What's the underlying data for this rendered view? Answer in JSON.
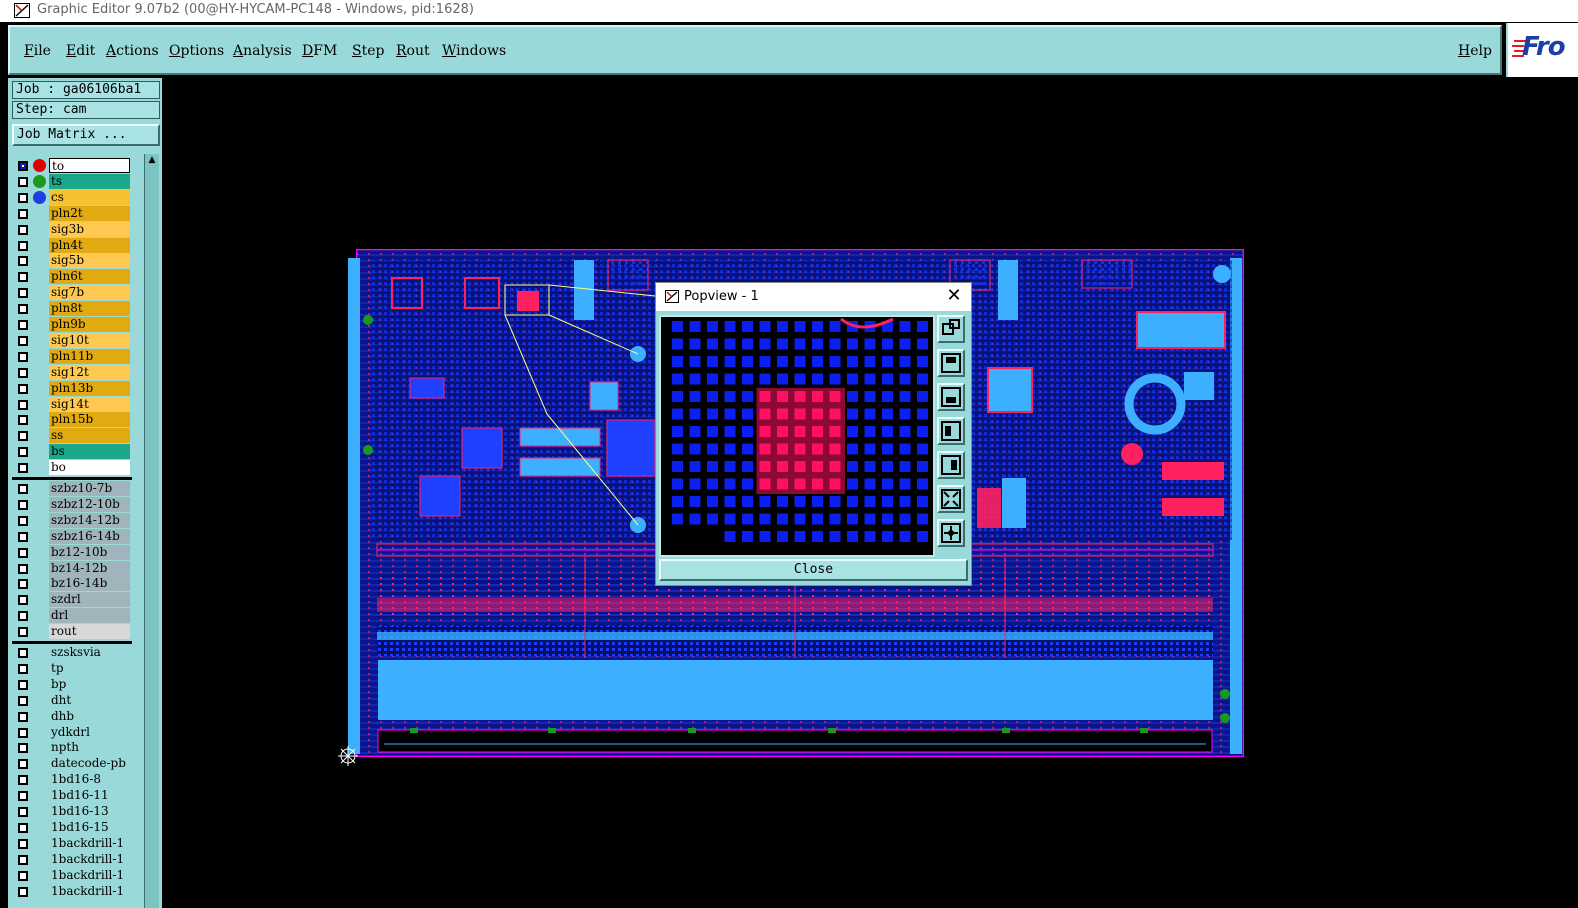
{
  "window": {
    "title": "Graphic Editor 9.07b2 (00@HY-HYCAM-PC148 - Windows, pid:1628)"
  },
  "menu": {
    "items": [
      {
        "label": "File",
        "name": "file"
      },
      {
        "label": "Edit",
        "name": "edit"
      },
      {
        "label": "Actions",
        "name": "actions"
      },
      {
        "label": "Options",
        "name": "options"
      },
      {
        "label": "Analysis",
        "name": "analysis"
      },
      {
        "label": "DFM",
        "name": "dfm"
      },
      {
        "label": "Step",
        "name": "step"
      },
      {
        "label": "Rout",
        "name": "rout"
      },
      {
        "label": "Windows",
        "name": "windows"
      }
    ],
    "help": "Help",
    "logo": "Fro"
  },
  "panel": {
    "job": "Job : ga06106ba1",
    "step": "Step: cam",
    "job_matrix": "Job Matrix ..."
  },
  "layers": {
    "board": [
      {
        "name": "to",
        "bg": "#ffffff",
        "dot": "#e00000",
        "checked": true,
        "active": true
      },
      {
        "name": "ts",
        "bg": "#1aa78a",
        "dot": "#1a9a1a"
      },
      {
        "name": "cs",
        "bg": "#f4c230",
        "dot": "#1f3fe0"
      },
      {
        "name": "pln2t",
        "bg": "#e0aa10"
      },
      {
        "name": "sig3b",
        "bg": "#ffc850"
      },
      {
        "name": "pln4t",
        "bg": "#e0aa10"
      },
      {
        "name": "sig5b",
        "bg": "#ffc850"
      },
      {
        "name": "pln6t",
        "bg": "#e0aa10"
      },
      {
        "name": "sig7b",
        "bg": "#ffc850"
      },
      {
        "name": "pln8t",
        "bg": "#e0aa10"
      },
      {
        "name": "pln9b",
        "bg": "#e0aa10"
      },
      {
        "name": "sig10t",
        "bg": "#ffc850"
      },
      {
        "name": "pln11b",
        "bg": "#e0aa10"
      },
      {
        "name": "sig12t",
        "bg": "#ffc850"
      },
      {
        "name": "pln13b",
        "bg": "#e0aa10"
      },
      {
        "name": "sig14t",
        "bg": "#ffc850"
      },
      {
        "name": "pln15b",
        "bg": "#e0aa10"
      },
      {
        "name": "ss",
        "bg": "#e0aa10"
      },
      {
        "name": "bs",
        "bg": "#1aa78a"
      },
      {
        "name": "bo",
        "bg": "#ffffff"
      }
    ],
    "drill": [
      {
        "name": "szbz10-7b",
        "bg": "#a0b4bc"
      },
      {
        "name": "szbz12-10b",
        "bg": "#a0b4bc"
      },
      {
        "name": "szbz14-12b",
        "bg": "#a0b4bc"
      },
      {
        "name": "szbz16-14b",
        "bg": "#a0b4bc"
      },
      {
        "name": "bz12-10b",
        "bg": "#a0b4bc"
      },
      {
        "name": "bz14-12b",
        "bg": "#a0b4bc"
      },
      {
        "name": "bz16-14b",
        "bg": "#a0b4bc"
      },
      {
        "name": "szdrl",
        "bg": "#a0b4bc"
      },
      {
        "name": "drl",
        "bg": "#a0b4bc"
      },
      {
        "name": "rout",
        "bg": "#d8d8d8"
      }
    ],
    "misc": [
      {
        "name": "szsksvia",
        "bg": "#9ad9d9"
      },
      {
        "name": "tp",
        "bg": "#9ad9d9"
      },
      {
        "name": "bp",
        "bg": "#9ad9d9"
      },
      {
        "name": "dht",
        "bg": "#9ad9d9"
      },
      {
        "name": "dhb",
        "bg": "#9ad9d9"
      },
      {
        "name": "ydkdrl",
        "bg": "#9ad9d9"
      },
      {
        "name": "npth",
        "bg": "#9ad9d9"
      },
      {
        "name": "datecode-pb",
        "bg": "#9ad9d9"
      },
      {
        "name": "1bd16-8",
        "bg": "#9ad9d9"
      },
      {
        "name": "1bd16-11",
        "bg": "#9ad9d9"
      },
      {
        "name": "1bd16-13",
        "bg": "#9ad9d9"
      },
      {
        "name": "1bd16-15",
        "bg": "#9ad9d9"
      },
      {
        "name": "1backdrill-1",
        "bg": "#9ad9d9"
      },
      {
        "name": "1backdrill-1",
        "bg": "#9ad9d9"
      },
      {
        "name": "1backdrill-1",
        "bg": "#9ad9d9"
      },
      {
        "name": "1backdrill-1",
        "bg": "#9ad9d9"
      }
    ]
  },
  "popview": {
    "title": "Popview - 1",
    "close_label": "Close",
    "tool_icons": [
      "zoom-window-icon",
      "zoom-in-icon",
      "zoom-out-icon",
      "pan-left-icon",
      "pan-right-icon",
      "fit-all-icon",
      "center-icon"
    ]
  },
  "colors": {
    "panel": "#9ad9d9",
    "board_outline": "#ff00ff",
    "pads": "#0a1ff0",
    "highlight": "#ff1060"
  }
}
